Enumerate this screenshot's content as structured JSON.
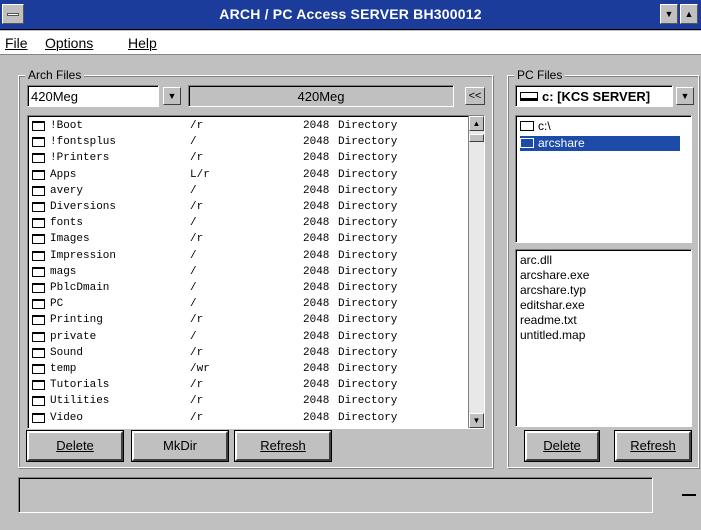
{
  "window": {
    "title": "ARCH / PC Access SERVER BH300012"
  },
  "menu": {
    "file": "File",
    "options": "Options",
    "help": "Help"
  },
  "arch": {
    "group_label": "Arch Files",
    "drive_value": "420Meg",
    "path_value": "420Meg",
    "copy_button": "<<",
    "files": [
      {
        "name": "!Boot",
        "attr": "/r",
        "size": "2048",
        "type": "Directory"
      },
      {
        "name": "!fontsplus",
        "attr": "/",
        "size": "2048",
        "type": "Directory"
      },
      {
        "name": "!Printers",
        "attr": "/r",
        "size": "2048",
        "type": "Directory"
      },
      {
        "name": "Apps",
        "attr": "L/r",
        "size": "2048",
        "type": "Directory"
      },
      {
        "name": "avery",
        "attr": "/",
        "size": "2048",
        "type": "Directory"
      },
      {
        "name": "Diversions",
        "attr": "/r",
        "size": "2048",
        "type": "Directory"
      },
      {
        "name": "fonts",
        "attr": "/",
        "size": "2048",
        "type": "Directory"
      },
      {
        "name": "Images",
        "attr": "/r",
        "size": "2048",
        "type": "Directory"
      },
      {
        "name": "Impression",
        "attr": "/",
        "size": "2048",
        "type": "Directory"
      },
      {
        "name": "mags",
        "attr": "/",
        "size": "2048",
        "type": "Directory"
      },
      {
        "name": "PblcDmain",
        "attr": "/",
        "size": "2048",
        "type": "Directory"
      },
      {
        "name": "PC",
        "attr": "/",
        "size": "2048",
        "type": "Directory"
      },
      {
        "name": "Printing",
        "attr": "/r",
        "size": "2048",
        "type": "Directory"
      },
      {
        "name": "private",
        "attr": "/",
        "size": "2048",
        "type": "Directory"
      },
      {
        "name": "Sound",
        "attr": "/r",
        "size": "2048",
        "type": "Directory"
      },
      {
        "name": "temp",
        "attr": "/wr",
        "size": "2048",
        "type": "Directory"
      },
      {
        "name": "Tutorials",
        "attr": "/r",
        "size": "2048",
        "type": "Directory"
      },
      {
        "name": "Utilities",
        "attr": "/r",
        "size": "2048",
        "type": "Directory"
      },
      {
        "name": "Video",
        "attr": "/r",
        "size": "2048",
        "type": "Directory"
      }
    ],
    "buttons": {
      "delete": "Delete",
      "mkdir": "MkDir",
      "refresh": "Refresh"
    }
  },
  "pc": {
    "group_label": "PC Files",
    "drive_value": "c: [KCS SERVER]",
    "tree": [
      {
        "label": "c:\\",
        "selected": false
      },
      {
        "label": "arcshare",
        "selected": true
      }
    ],
    "files": [
      "arc.dll",
      "arcshare.exe",
      "arcshare.typ",
      "editshar.exe",
      "readme.txt",
      "untitled.map"
    ],
    "buttons": {
      "delete": "Delete",
      "refresh": "Refresh"
    }
  },
  "colors": {
    "titlebar": "#1c3c9c",
    "selection": "#1c4ca8",
    "face": "#c0c0c0"
  }
}
